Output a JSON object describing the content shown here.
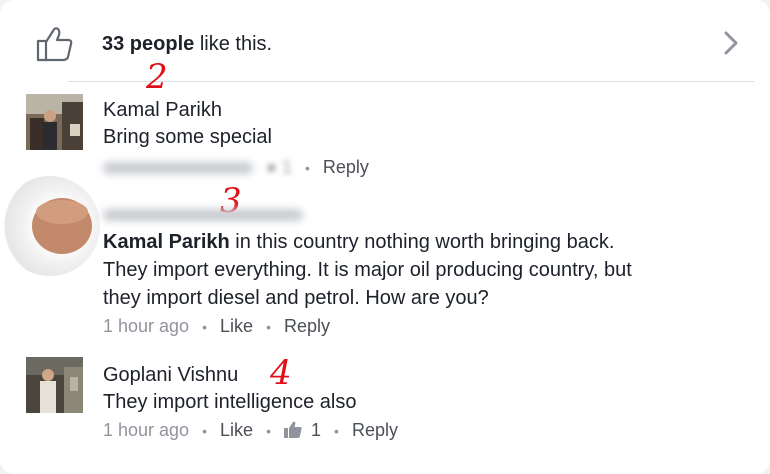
{
  "likes": {
    "count_text": "33 people",
    "suffix_text": "like this.",
    "icons": {
      "like": "thumbs-up-outline-icon",
      "chevron": "chevron-right-icon"
    }
  },
  "annotations": [
    "2",
    "3",
    "4"
  ],
  "comments": [
    {
      "author": "Kamal Parikh",
      "text": "Bring some special",
      "meta": {
        "count": "1",
        "reply": "Reply"
      }
    },
    {
      "mention": "Kamal Parikh",
      "text_after_mention": " in this country nothing worth bringing back.",
      "text_line2": "They import everything. It is major oil producing country, but",
      "text_line3": "they import diesel and petrol. How are you?",
      "meta": {
        "time": "1 hour ago",
        "like": "Like",
        "reply": "Reply"
      }
    },
    {
      "author": "Goplani Vishnu",
      "text": "They import intelligence also",
      "meta": {
        "time": "1 hour ago",
        "like": "Like",
        "count": "1",
        "reply": "Reply"
      }
    }
  ],
  "colors": {
    "annotation": "#e0101a",
    "text": "#1d2129",
    "meta": "#90949c"
  }
}
